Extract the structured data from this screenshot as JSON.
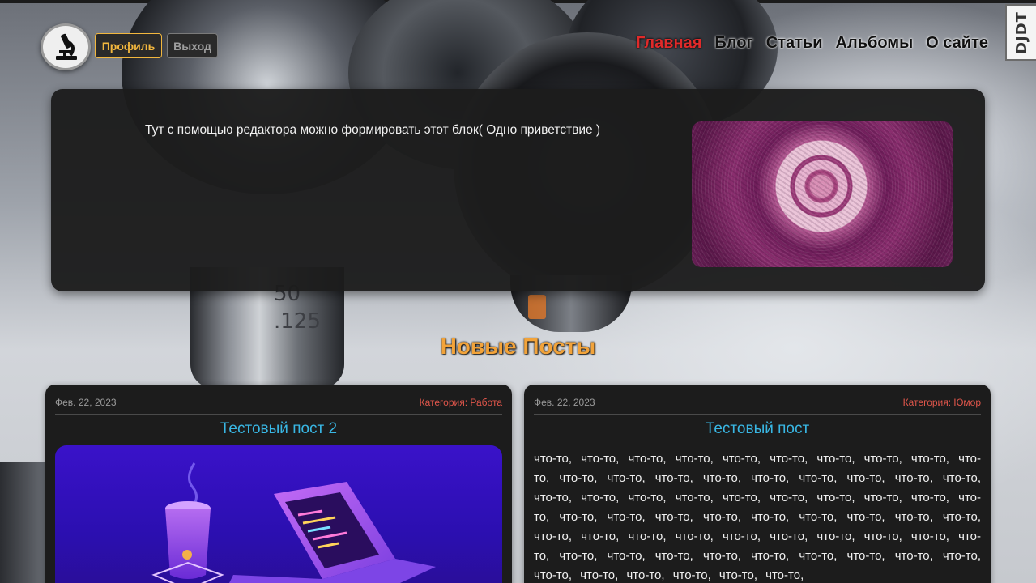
{
  "header": {
    "profile_label": "Профиль",
    "logout_label": "Выход",
    "nav": [
      {
        "label": "Главная",
        "active": true
      },
      {
        "label": "Блог",
        "active": false
      },
      {
        "label": "Статьи",
        "active": false
      },
      {
        "label": "Альбомы",
        "active": false
      },
      {
        "label": "О сайте",
        "active": false
      }
    ],
    "side_badge": "DJDT"
  },
  "hero": {
    "text": "Тут с помощью редактора можно формировать этот блок( Одно приветствие )"
  },
  "posts_section": {
    "title": "Новые Посты"
  },
  "posts": [
    {
      "date": "Фев. 22, 2023",
      "category": "Категория: Работа",
      "title": "Тестовый пост 2"
    },
    {
      "date": "Фев. 22, 2023",
      "category": "Категория: Юмор",
      "title": "Тестовый пост",
      "body": "что-то, что-то, что-то, что-то, что-то, что-то, что-то, что-то, что-то, что-то, что-то, что-то, что-то, что-то, что-то, что-то, что-то, что-то, что-то, что-то, что-то, что-то, что-то, что-то, что-то, что-то, что-то, что-то, что-то, что-то, что-то, что-то, что-то, что-то, что-то, что-то, что-то, что-то, что-то, что-то, что-то, что-то, что-то, что-то, что-то, что-то, что-то, что-то, что-то, что-то, что-то, что-то, что-то, что-то, что-то, что-то, что-то, что-то, что-то, что-то, что-то, что-то, что-то,"
    }
  ],
  "colors": {
    "nav_active": "#e02a2a",
    "profile_accent": "#f2b73e",
    "section_title": "#f2a33a",
    "post_title": "#39b7e4",
    "category": "#e0564b"
  },
  "icons": {
    "logo": "microscope-icon"
  }
}
